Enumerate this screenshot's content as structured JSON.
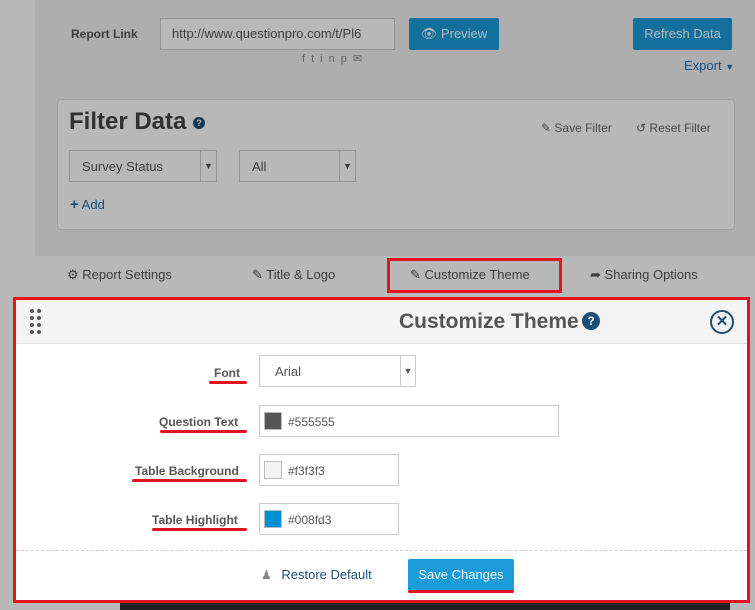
{
  "background": {
    "report_link_label": "Report Link",
    "report_link_value": "http://www.questionpro.com/t/Pl6",
    "preview_label": "Preview",
    "refresh_label": "Refresh Data",
    "social_icons": [
      "facebook-icon",
      "twitter-icon",
      "linkedin-icon",
      "pinterest-icon",
      "mail-icon"
    ],
    "export_label": "Export",
    "filter": {
      "title": "Filter Data",
      "save_filter": "Save Filter",
      "reset_filter": "Reset Filter",
      "select1": "Survey Status",
      "select2": "All",
      "add": "Add"
    },
    "tabs": [
      {
        "label": "Report Settings",
        "icon": "gears-icon"
      },
      {
        "label": "Title & Logo",
        "icon": "edit-icon"
      },
      {
        "label": "Customize Theme",
        "icon": "edit-icon"
      },
      {
        "label": "Sharing Options",
        "icon": "share-icon"
      }
    ]
  },
  "modal": {
    "title": "Customize Theme",
    "fields": {
      "font": {
        "label": "Font",
        "value": "Arial"
      },
      "question_text": {
        "label": "Question Text",
        "value": "#555555",
        "color": "#555555"
      },
      "table_background": {
        "label": "Table Background",
        "value": "#f3f3f3",
        "color": "#f3f3f3"
      },
      "table_highlight": {
        "label": "Table Highlight",
        "value": "#008fd3",
        "color": "#008fd3"
      }
    },
    "restore_default": "Restore Default",
    "save_changes": "Save Changes"
  },
  "colors": {
    "accent_button": "#1b9cd8",
    "annotation_red": "#e0141e",
    "dark_blue": "#1b4f78"
  }
}
